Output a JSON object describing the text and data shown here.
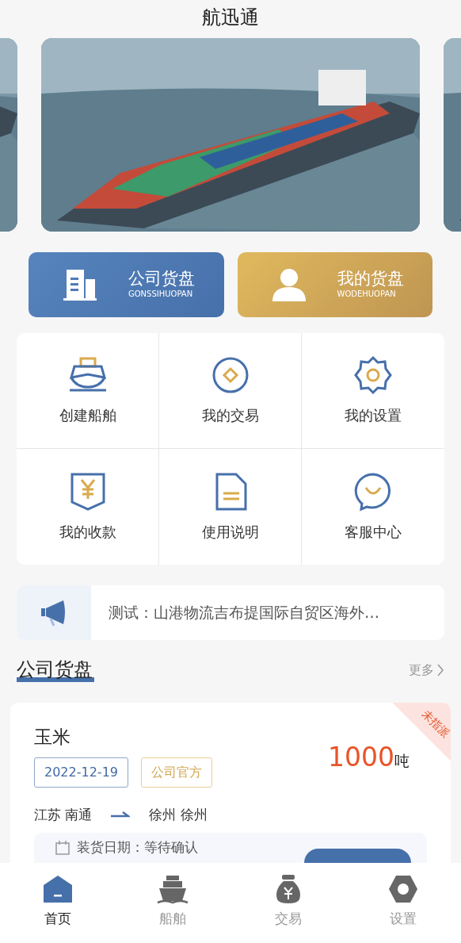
{
  "header": {
    "title": "航迅通"
  },
  "shortcuts": [
    {
      "kind": "company",
      "title": "公司货盘",
      "subtitle": "GONSSIHUOPAN"
    },
    {
      "kind": "mine",
      "title": "我的货盘",
      "subtitle": "WODEHUOPAN"
    }
  ],
  "menu": [
    {
      "kind": "ship",
      "label": "创建船舶"
    },
    {
      "kind": "trade",
      "label": "我的交易"
    },
    {
      "kind": "settings",
      "label": "我的设置"
    },
    {
      "kind": "payment",
      "label": "我的收款"
    },
    {
      "kind": "document",
      "label": "使用说明"
    },
    {
      "kind": "service",
      "label": "客服中心"
    }
  ],
  "notice": {
    "text": "测试：山港物流吉布提国际自贸区海外…"
  },
  "section": {
    "title": "公司货盘",
    "more": "更多"
  },
  "cargo": {
    "name": "玉米",
    "date": "2022-12-19",
    "tag": "公司官方",
    "amount": "1000",
    "unit": "吨",
    "status": "未指派",
    "from": "江苏 南通",
    "to": "徐州 徐州",
    "loading": "装货日期：等待确认"
  },
  "tabbar": [
    {
      "kind": "home",
      "label": "首页",
      "selected": true
    },
    {
      "kind": "ship",
      "label": "船舶",
      "selected": false
    },
    {
      "kind": "money",
      "label": "交易",
      "selected": false
    },
    {
      "kind": "settings",
      "label": "设置",
      "selected": false
    }
  ]
}
